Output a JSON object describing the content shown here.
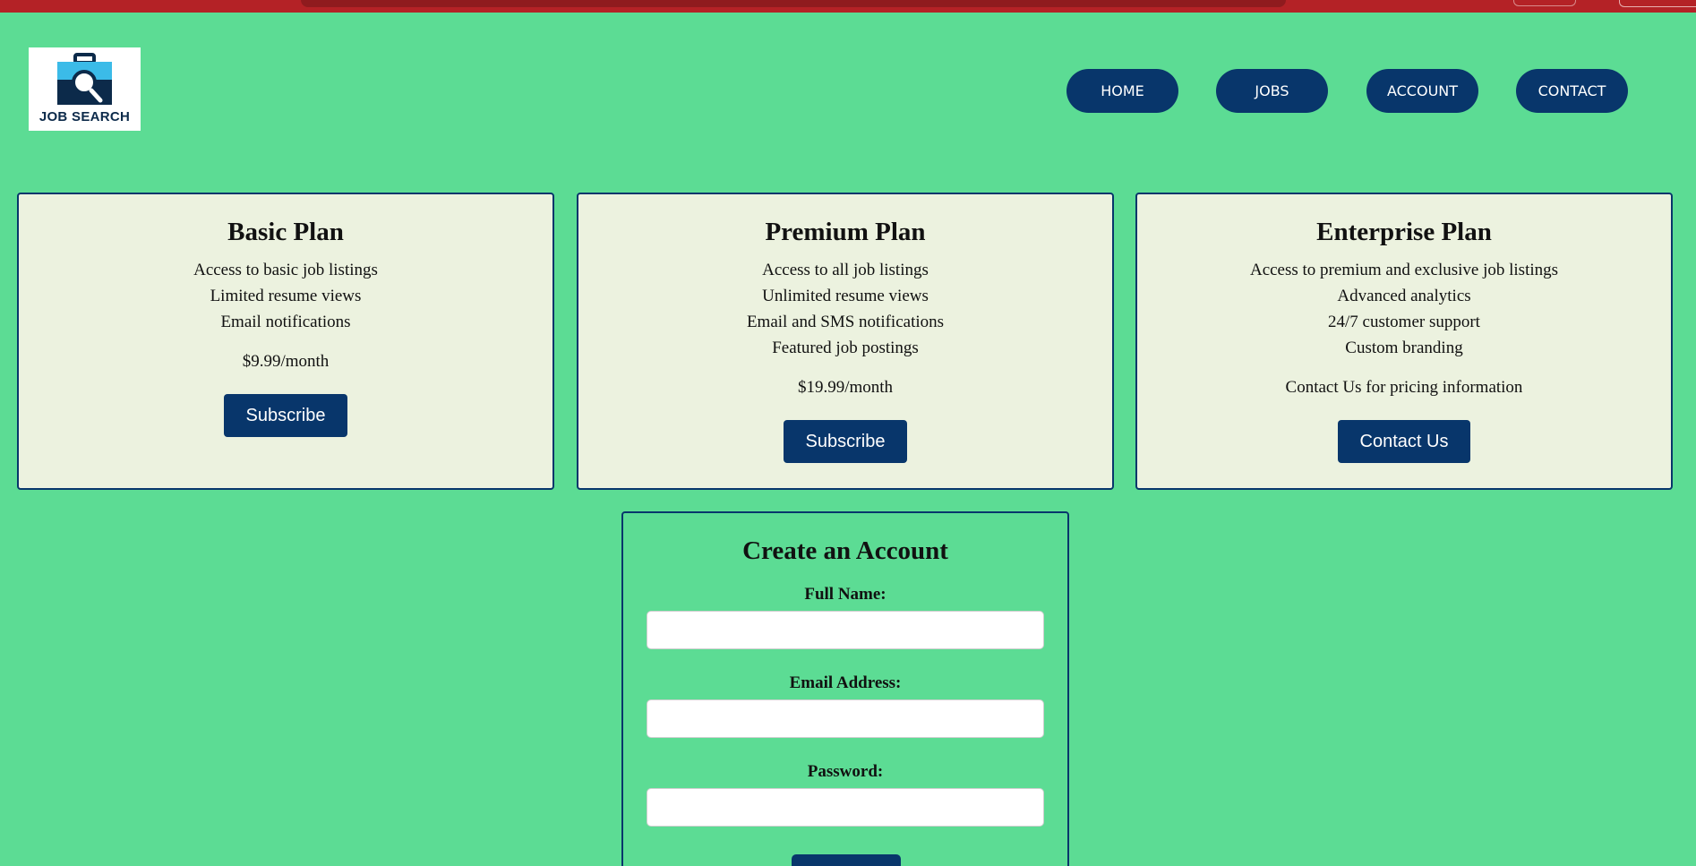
{
  "logo": {
    "text": "JOB SEARCH"
  },
  "nav": {
    "items": [
      {
        "label": "HOME"
      },
      {
        "label": "JOBS"
      },
      {
        "label": "ACCOUNT"
      },
      {
        "label": "CONTACT"
      }
    ]
  },
  "plans": [
    {
      "title": "Basic Plan",
      "features": [
        "Access to basic job listings",
        "Limited resume views",
        "Email notifications"
      ],
      "price": "$9.99/month",
      "button": "Subscribe"
    },
    {
      "title": "Premium Plan",
      "features": [
        "Access to all job listings",
        "Unlimited resume views",
        "Email and SMS notifications",
        "Featured job postings"
      ],
      "price": "$19.99/month",
      "button": "Subscribe"
    },
    {
      "title": "Enterprise Plan",
      "features": [
        "Access to premium and exclusive job listings",
        "Advanced analytics",
        "24/7 customer support",
        "Custom branding"
      ],
      "price": "Contact Us for pricing information",
      "button": "Contact Us"
    }
  ],
  "account_form": {
    "title": "Create an Account",
    "fields": [
      {
        "label": "Full Name:",
        "value": ""
      },
      {
        "label": "Email Address:",
        "value": ""
      },
      {
        "label": "Password:",
        "value": ""
      }
    ]
  },
  "colors": {
    "background": "#5cdc94",
    "primary": "#08366b",
    "card": "#ecf2df",
    "browser_bar": "#b42226"
  },
  "icons": [
    "briefcase-magnifier-icon"
  ]
}
